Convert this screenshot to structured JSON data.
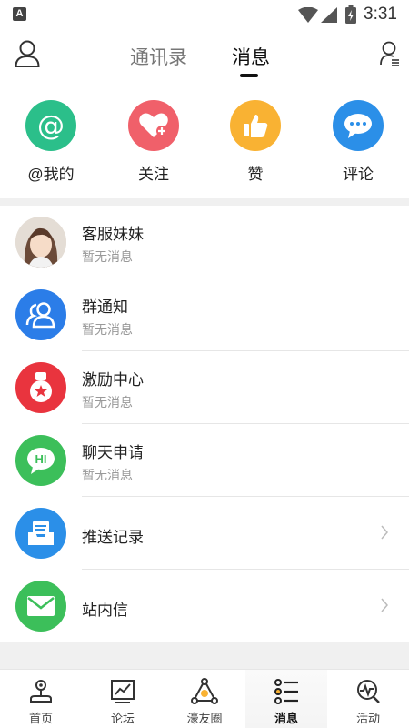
{
  "status_bar": {
    "time": "3:31",
    "app_badge": "A"
  },
  "header": {
    "tabs": [
      {
        "label": "通讯录"
      },
      {
        "label": "消息"
      }
    ]
  },
  "quick_actions": [
    {
      "label": "@我的",
      "icon": "at-icon",
      "color": "#2bbf8a"
    },
    {
      "label": "关注",
      "icon": "heart-plus-icon",
      "color": "#f0606a"
    },
    {
      "label": "赞",
      "icon": "thumbs-up-icon",
      "color": "#f9b233"
    },
    {
      "label": "评论",
      "icon": "comment-icon",
      "color": "#2b8fe8"
    }
  ],
  "messages": [
    {
      "title": "客服妹妹",
      "subtitle": "暂无消息"
    },
    {
      "title": "群通知",
      "subtitle": "暂无消息"
    },
    {
      "title": "激励中心",
      "subtitle": "暂无消息"
    },
    {
      "title": "聊天申请",
      "subtitle": "暂无消息"
    }
  ],
  "links": [
    {
      "title": "推送记录"
    },
    {
      "title": "站内信"
    }
  ],
  "bottom_nav": [
    {
      "label": "首页"
    },
    {
      "label": "论坛"
    },
    {
      "label": "濠友圈"
    },
    {
      "label": "消息"
    },
    {
      "label": "活动"
    }
  ]
}
